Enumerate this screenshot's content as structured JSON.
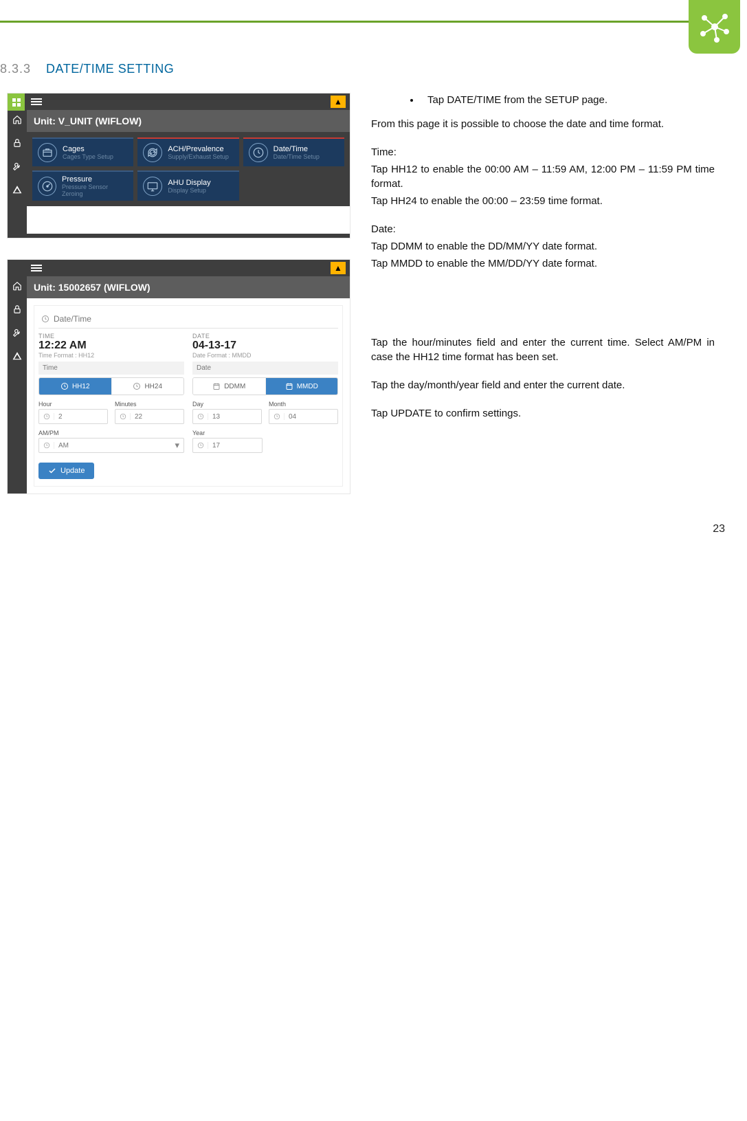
{
  "header": {
    "section_number": "8.3.3",
    "section_title": "DATE/TIME SETTING"
  },
  "instructions": {
    "bullet1": "Tap DATE/TIME from the SETUP page.",
    "intro": "From this page it is possible to choose the date and time format.",
    "time_label": "Time:",
    "time_hh12": "Tap HH12 to enable the 00:00 AM – 11:59 AM, 12:00 PM – 11:59 PM time format.",
    "time_hh24": "Tap HH24 to enable the 00:00 – 23:59 time format.",
    "date_label": "Date:",
    "date_ddmm": "Tap DDMM to enable the DD/MM/YY date format.",
    "date_mmdd": "Tap MMDD to enable the MM/DD/YY date format.",
    "hourmin": "Tap the hour/minutes field and enter the current time. Select AM/PM in case the HH12 time format has been set.",
    "dmy": "Tap the day/month/year field and enter the current date.",
    "update": "Tap UPDATE to confirm settings."
  },
  "shot1": {
    "unit_title": "Unit: V_UNIT (WIFLOW)",
    "tiles": [
      {
        "title": "Cages",
        "sub": "Cages Type Setup",
        "icon": "box-icon",
        "selected": false
      },
      {
        "title": "ACH/Prevalence",
        "sub": "Supply/Exhaust Setup",
        "icon": "refresh-icon",
        "selected": true
      },
      {
        "title": "Date/Time",
        "sub": "Date/Time Setup",
        "icon": "clock-icon",
        "selected": true
      },
      {
        "title": "Pressure",
        "sub": "Pressure Sensor Zeroing",
        "icon": "gauge-icon",
        "selected": false
      },
      {
        "title": "AHU Display",
        "sub": "Display Setup",
        "icon": "monitor-icon",
        "selected": false
      }
    ]
  },
  "shot2": {
    "unit_title": "Unit: 15002657 (WIFLOW)",
    "panel_title": "Date/Time",
    "time_section_label": "TIME",
    "time_value": "12:22 AM",
    "time_format_label": "Time Format : HH12",
    "time_group_header": "Time",
    "date_section_label": "DATE",
    "date_value": "04-13-17",
    "date_format_label": "Date Format : MMDD",
    "date_group_header": "Date",
    "seg_time": [
      {
        "label": "HH12",
        "active": true
      },
      {
        "label": "HH24",
        "active": false
      }
    ],
    "seg_date": [
      {
        "label": "DDMM",
        "active": false
      },
      {
        "label": "MMDD",
        "active": true
      }
    ],
    "fields": {
      "hour_label": "Hour",
      "hour": "2",
      "min_label": "Minutes",
      "min": "22",
      "ampm_label": "AM/PM",
      "ampm": "AM",
      "day_label": "Day",
      "day": "13",
      "month_label": "Month",
      "month": "04",
      "year_label": "Year",
      "year": "17"
    },
    "update_label": "Update"
  },
  "page_number": "23"
}
